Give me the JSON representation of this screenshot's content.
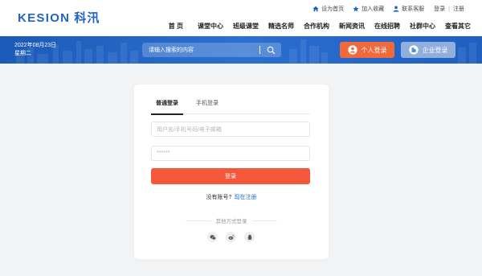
{
  "brand": {
    "logo_en": "KESION",
    "logo_cn": "科汛",
    "color": "#1e63c6"
  },
  "toplinks": [
    {
      "label": "设为首页",
      "icon": "home-icon"
    },
    {
      "label": "加入收藏",
      "icon": "star-icon"
    },
    {
      "label": "联系客服",
      "icon": "user-icon"
    }
  ],
  "auth": {
    "login": "登录",
    "separator": "|",
    "register": "注册"
  },
  "nav": [
    "首 页",
    "课堂中心",
    "班级课堂",
    "精选名师",
    "合作机构",
    "新闻资讯",
    "在线招聘",
    "社群中心",
    "查看其它"
  ],
  "banner": {
    "date": "2022年08月23日",
    "weekday": "星期二",
    "search_placeholder": "请输入搜索的内容",
    "personal_login": "个人登录",
    "enterprise_login": "企业登录"
  },
  "login": {
    "tabs": [
      "普通登录",
      "手机登录"
    ],
    "username_placeholder": "用户名/手机号码/电子邮箱",
    "password_mask": "******",
    "submit": "登录",
    "no_account": "没有账号?",
    "register_now": "现在注册",
    "other_methods": "其他方式登录",
    "socials": [
      "wechat-icon",
      "weibo-icon",
      "qq-icon"
    ]
  },
  "colors": {
    "accent": "#f4573a",
    "banner": "#2b6fd0",
    "personal_btn": "#f06a3c",
    "enterprise_btn": "#8fb0dd",
    "link": "#1e6ad0"
  }
}
